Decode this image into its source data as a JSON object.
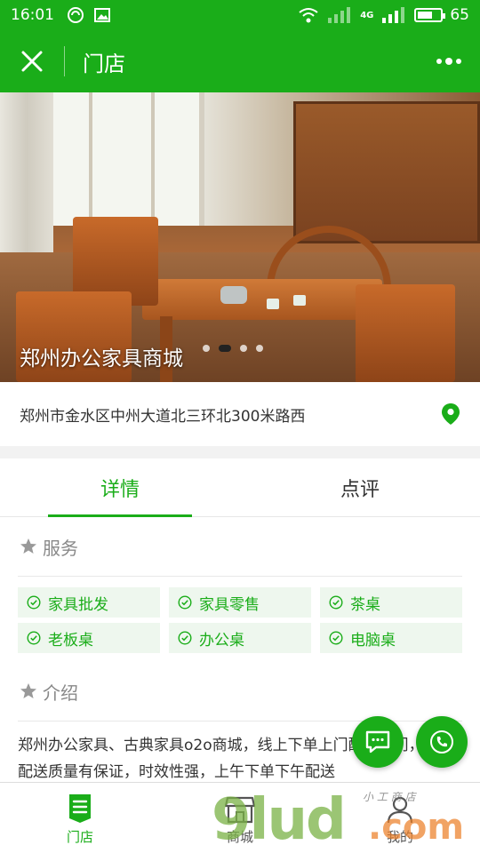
{
  "status_bar": {
    "time": "16:01",
    "network": "4G",
    "battery": "65",
    "battery_level": 0.65
  },
  "nav": {
    "title": "门店"
  },
  "banner": {
    "title": "郑州办公家具商城",
    "slide_count": 4,
    "active_slide": 2
  },
  "store": {
    "address": "郑州市金水区中州大道北三环北300米路西"
  },
  "tabs": [
    {
      "label": "详情",
      "active": true
    },
    {
      "label": "点评",
      "active": false
    }
  ],
  "services": {
    "heading": "服务",
    "items": [
      "家具批发",
      "家具零售",
      "茶桌",
      "老板桌",
      "办公桌",
      "电脑桌"
    ]
  },
  "intro": {
    "heading": "介绍",
    "text": "郑州办公家具、古典家具o2o商城，线上下单上门配送上门，同城配送质量有保证，时效性强，上午下单下午配送"
  },
  "bottom_nav": [
    {
      "label": "门店",
      "icon": "store-icon",
      "active": true
    },
    {
      "label": "商城",
      "icon": "shop-icon",
      "active": false
    },
    {
      "label": "我的",
      "icon": "user-icon",
      "active": false
    }
  ],
  "watermark": {
    "brand": "9lud",
    "domain": ".com",
    "tagline": "小 工 商 店"
  },
  "colors": {
    "brand_green": "#1aad19",
    "service_bg": "#eef7ee"
  }
}
